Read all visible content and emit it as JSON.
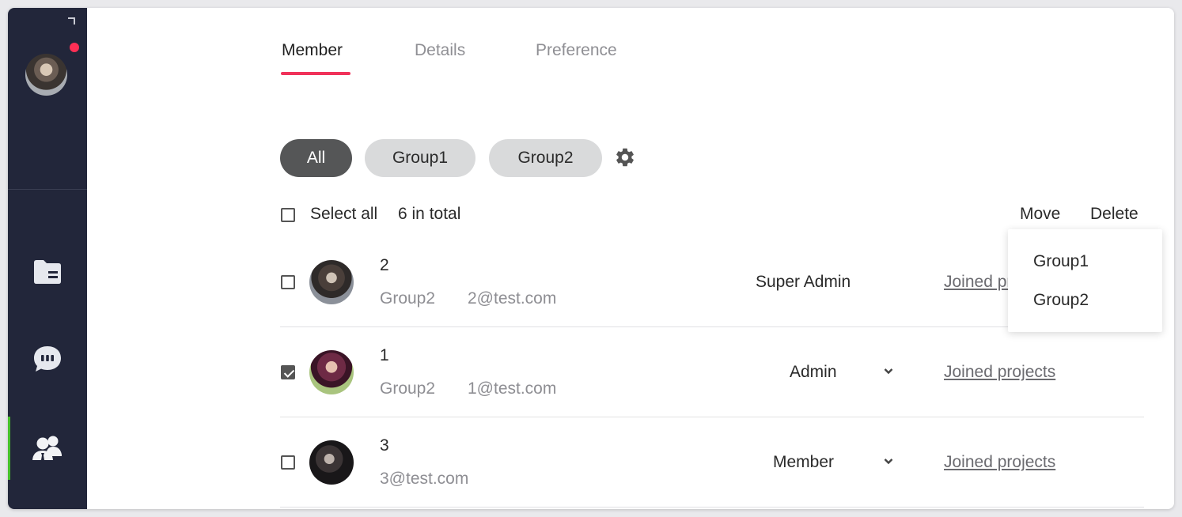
{
  "tabs": [
    {
      "label": "Member",
      "active": true
    },
    {
      "label": "Details",
      "active": false
    },
    {
      "label": "Preference",
      "active": false
    }
  ],
  "filters": [
    {
      "label": "All",
      "active": true
    },
    {
      "label": "Group1",
      "active": false
    },
    {
      "label": "Group2",
      "active": false
    }
  ],
  "toolbar": {
    "select_all_label": "Select all",
    "total_label": "6 in total",
    "move_label": "Move",
    "delete_label": "Delete"
  },
  "members": [
    {
      "name": "2",
      "group": "Group2",
      "email": "2@test.com",
      "role": "Super Admin",
      "has_role_dropdown": false,
      "checked": false,
      "link": "Joined projects"
    },
    {
      "name": "1",
      "group": "Group2",
      "email": "1@test.com",
      "role": "Admin",
      "has_role_dropdown": true,
      "checked": true,
      "link": "Joined projects"
    },
    {
      "name": "3",
      "group": "",
      "email": "3@test.com",
      "role": "Member",
      "has_role_dropdown": true,
      "checked": false,
      "link": "Joined projects"
    }
  ],
  "move_menu": {
    "items": [
      "Group1",
      "Group2"
    ]
  },
  "sidebar": {
    "nav": [
      {
        "icon": "folder-icon",
        "active": false
      },
      {
        "icon": "chat-icon",
        "active": false
      },
      {
        "icon": "users-icon",
        "active": true
      }
    ],
    "has_notification": true
  },
  "colors": {
    "sidebar_bg": "#22263a",
    "tab_underline": "#f0325a",
    "active_nav_indicator": "#47c12a",
    "notification_dot": "#ff2f55",
    "chip_active_bg": "#555657",
    "chip_bg": "#d9dadb"
  }
}
